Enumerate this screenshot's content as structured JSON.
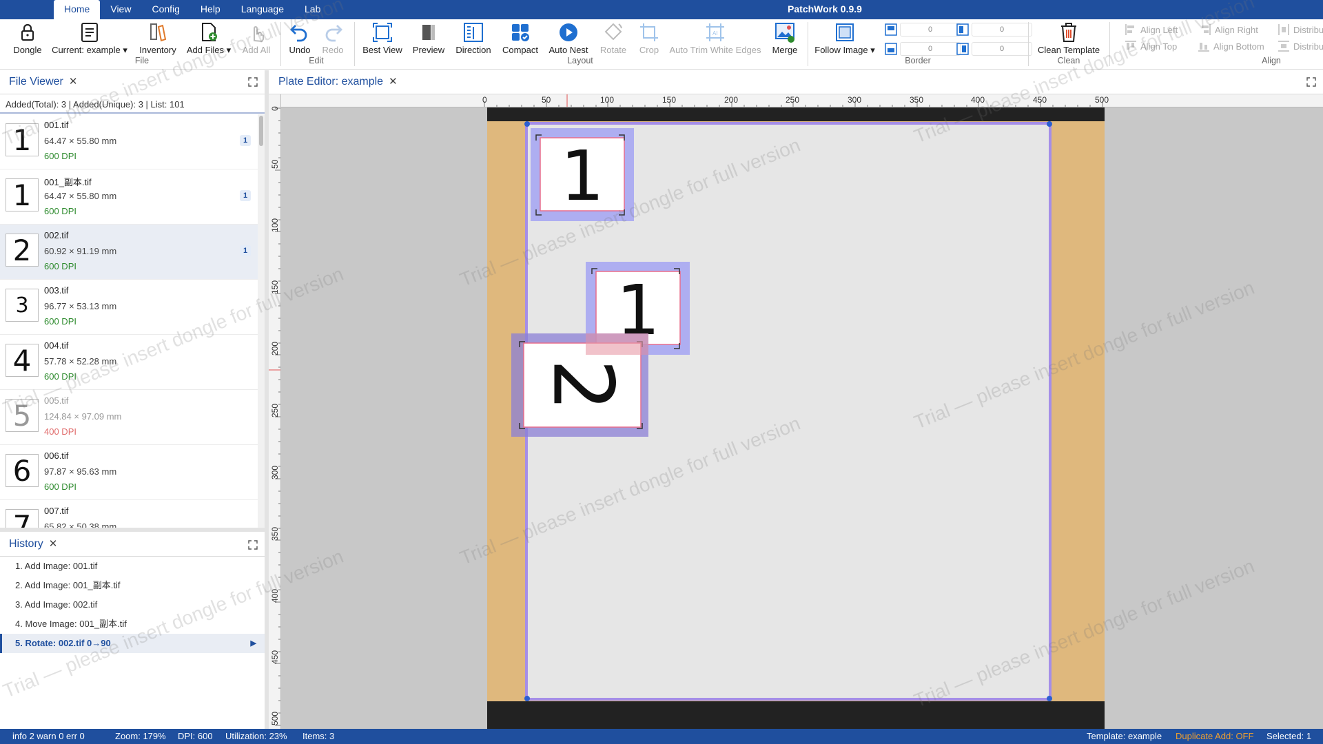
{
  "app": {
    "title": "PatchWork 0.9.9"
  },
  "menu": [
    "Home",
    "View",
    "Config",
    "Help",
    "Language",
    "Lab"
  ],
  "ribbon": {
    "dongle": "Dongle",
    "current": "Current: example",
    "inventory": "Inventory",
    "add_files": "Add Files",
    "add_all": "Add All",
    "group_file": "File",
    "undo": "Undo",
    "redo": "Redo",
    "group_edit": "Edit",
    "best_view": "Best View",
    "preview": "Preview",
    "direction": "Direction",
    "compact": "Compact",
    "auto_nest": "Auto Nest",
    "rotate": "Rotate",
    "crop": "Crop",
    "auto_trim": "Auto Trim White Edges",
    "merge": "Merge",
    "group_layout": "Layout",
    "follow_image": "Follow Image",
    "border_values": [
      "0",
      "0",
      "0",
      "0"
    ],
    "group_border": "Border",
    "clean_template": "Clean Template",
    "group_clean": "Clean",
    "align_left": "Align Left",
    "align_top": "Align Top",
    "align_right": "Align Right",
    "align_bottom": "Align Bottom",
    "distribute_1": "Distribu",
    "distribute_2": "Distribu",
    "group_align": "Align"
  },
  "file_viewer": {
    "tab": "File Viewer",
    "info": "Added(Total): 3 | Added(Unique): 3 | List: 101",
    "files": [
      {
        "thumb": "1",
        "name": "001.tif",
        "size": "64.47 × 55.80 mm",
        "dpi": "600 DPI",
        "count": "1"
      },
      {
        "thumb": "1",
        "name": "001_副本.tif",
        "size": "64.47 × 55.80 mm",
        "dpi": "600 DPI",
        "count": "1"
      },
      {
        "thumb": "2",
        "name": "002.tif",
        "size": "60.92 × 91.19 mm",
        "dpi": "600 DPI",
        "count": "1"
      },
      {
        "thumb": "3",
        "name": "003.tif",
        "size": "96.77 × 53.13 mm",
        "dpi": "600 DPI",
        "count": ""
      },
      {
        "thumb": "4",
        "name": "004.tif",
        "size": "57.78 × 52.28 mm",
        "dpi": "600 DPI",
        "count": ""
      },
      {
        "thumb": "5",
        "name": "005.tif",
        "size": "124.84 × 97.09 mm",
        "dpi": "400 DPI",
        "count": ""
      },
      {
        "thumb": "6",
        "name": "006.tif",
        "size": "97.87 × 95.63 mm",
        "dpi": "600 DPI",
        "count": ""
      },
      {
        "thumb": "7",
        "name": "007.tif",
        "size": "65.82 × 50.38 mm",
        "dpi": "",
        "count": ""
      }
    ]
  },
  "history": {
    "tab": "History",
    "items": [
      "1. Add Image: 001.tif",
      "2. Add Image: 001_副本.tif",
      "3. Add Image: 002.tif",
      "4. Move Image: 001_副本.tif",
      "5. Rotate: 002.tif 0→90"
    ]
  },
  "editor": {
    "tab": "Plate Editor: example",
    "h_ticks": [
      "0",
      "50",
      "100",
      "150",
      "200",
      "250",
      "300",
      "350",
      "400",
      "450",
      "500"
    ],
    "v_ticks": [
      "0",
      "50",
      "100",
      "150",
      "200",
      "250",
      "300",
      "350",
      "400",
      "450",
      "500"
    ],
    "images": [
      {
        "name": "001.tif",
        "digit": "1"
      },
      {
        "name": "001_副本.tif",
        "digit": "1"
      },
      {
        "name": "002.tif",
        "digit": "2"
      }
    ]
  },
  "status": {
    "log": "info 2  warn 0  err 0",
    "zoom": "Zoom: 179%",
    "dpi": "DPI: 600",
    "utilization": "Utilization: 23%",
    "items": "Items: 3",
    "template": "Template: example",
    "duplicate": "Duplicate Add: OFF",
    "selected": "Selected: 1"
  },
  "watermark": "Trial — please insert dongle for full version",
  "colors": {
    "accent": "#1f4f9e",
    "plate": "#dfb87d",
    "selection": "#9b9bf0",
    "warning": "#f0a030"
  }
}
